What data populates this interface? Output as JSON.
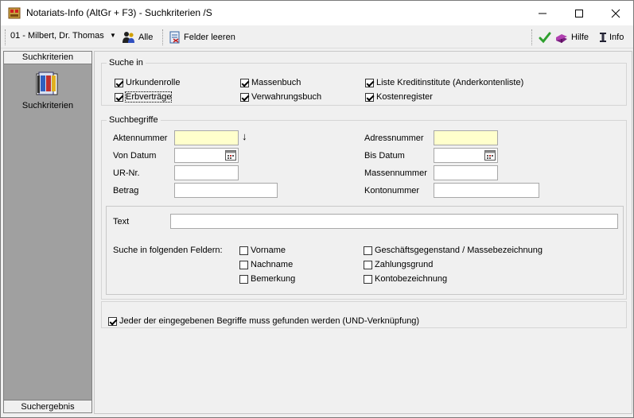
{
  "window": {
    "title": "Notariats-Info (AltGr + F3) - Suchkriterien /S",
    "controls": {
      "minimize": "—",
      "maximize": "☐",
      "close": "✕"
    }
  },
  "toolbar": {
    "user": "01 - Milbert, Dr. Thomas",
    "alle": "Alle",
    "felder_leeren": "Felder leeren",
    "hilfe": "Hilfe",
    "info": "Info",
    "check_color": "#2ea02e"
  },
  "leftpanel": {
    "header": "Suchkriterien",
    "item_label": "Suchkriterien",
    "footer": "Suchergebnis"
  },
  "suche_in": {
    "title": "Suche in",
    "items": [
      {
        "label": "Urkundenrolle",
        "checked": true
      },
      {
        "label": "Erbverträge",
        "checked": true
      },
      {
        "label": "Massenbuch",
        "checked": true
      },
      {
        "label": "Verwahrungsbuch",
        "checked": true
      },
      {
        "label": "Liste Kreditinstitute (Anderkontenliste)",
        "checked": true
      },
      {
        "label": "Kostenregister",
        "checked": true
      }
    ]
  },
  "suchbegriffe": {
    "title": "Suchbegriffe",
    "aktennummer": {
      "label": "Aktennummer",
      "value": ""
    },
    "sort_arrow": "↓",
    "von_datum": {
      "label": "Von Datum",
      "value": ""
    },
    "ur_nr": {
      "label": "UR-Nr.",
      "value": ""
    },
    "betrag": {
      "label": "Betrag",
      "value": ""
    },
    "adressnummer": {
      "label": "Adressnummer",
      "value": ""
    },
    "bis_datum": {
      "label": "Bis Datum",
      "value": ""
    },
    "massennummer": {
      "label": "Massennummer",
      "value": ""
    },
    "kontonummer": {
      "label": "Kontonummer",
      "value": ""
    }
  },
  "text_section": {
    "text_label": "Text",
    "text_value": "",
    "felder_label": "Suche in folgenden Feldern:",
    "fields": [
      {
        "label": "Vorname",
        "checked": false
      },
      {
        "label": "Nachname",
        "checked": false
      },
      {
        "label": "Bemerkung",
        "checked": false
      },
      {
        "label": "Geschäftsgegenstand / Massebezeichnung",
        "checked": false
      },
      {
        "label": "Zahlungsgrund",
        "checked": false
      },
      {
        "label": "Kontobezeichnung",
        "checked": false
      }
    ]
  },
  "und_option": {
    "label": "Jeder der eingegebenen Begriffe muss gefunden werden (UND-Verknüpfung)",
    "checked": true
  }
}
